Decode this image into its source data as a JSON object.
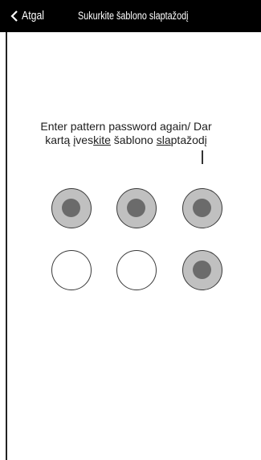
{
  "header": {
    "back_label": "Atgal",
    "title": "Sukurkite šablono slaptažodį"
  },
  "instruction": {
    "line1": "Enter pattern password again/  Dar",
    "line2": {
      "part1": "kartą įves",
      "part2": "kite",
      "part3": " šablono ",
      "part4": "sla",
      "part5": "ptažodį"
    }
  },
  "pattern": {
    "dots": [
      {
        "selected": true
      },
      {
        "selected": true
      },
      {
        "selected": true
      },
      {
        "selected": false
      },
      {
        "selected": false
      },
      {
        "selected": true
      }
    ]
  },
  "colors": {
    "header_bg": "#000000",
    "dot_ring_selected": "#c0c0c0",
    "dot_center_selected": "#6b6b6b"
  }
}
